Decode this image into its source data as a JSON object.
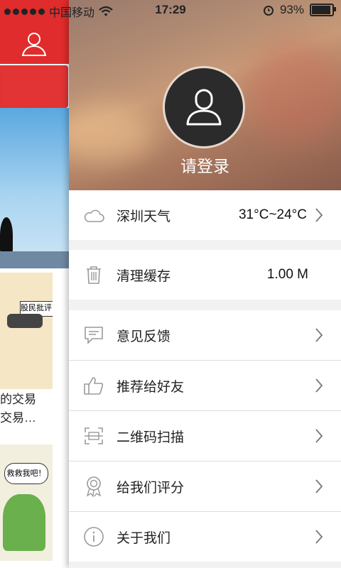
{
  "status_bar": {
    "carrier": "中国移动",
    "time": "17:29",
    "battery": "93%"
  },
  "background": {
    "caption_line1": "的交易",
    "caption_line2": "交易…",
    "comic1_sign": "股民批评",
    "comic2_bubble": "救救我吧！"
  },
  "profile": {
    "login_label": "请登录"
  },
  "menu": {
    "weather": {
      "label": "深圳天气",
      "value": "31°C~24°C",
      "icon": "cloud-icon"
    },
    "cache": {
      "label": "清理缓存",
      "value": "1.00 M",
      "icon": "trash-icon"
    },
    "items": [
      {
        "label": "意见反馈",
        "icon": "feedback-icon"
      },
      {
        "label": "推荐给好友",
        "icon": "thumbs-up-icon"
      },
      {
        "label": "二维码扫描",
        "icon": "scan-icon"
      },
      {
        "label": "给我们评分",
        "icon": "award-icon"
      },
      {
        "label": "关于我们",
        "icon": "info-icon"
      }
    ]
  },
  "colors": {
    "accent": "#e02c2c",
    "icon": "#9a9a9a"
  }
}
